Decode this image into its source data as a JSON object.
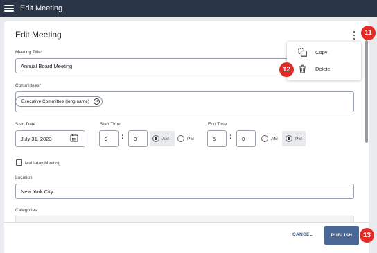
{
  "topbar": {
    "title": "Edit Meeting"
  },
  "card": {
    "title": "Edit Meeting"
  },
  "form": {
    "meeting_title_label": "Meeting Title*",
    "meeting_title_value": "Annual Board Meeting",
    "committees_label": "Committees*",
    "committee_chip": "Executive Committee (long name)",
    "start_date_label": "Start Date",
    "start_date_value": "July 31, 2023",
    "start_time_label": "Start Time",
    "start_hour": "9",
    "start_minute": "0",
    "end_time_label": "End Time",
    "end_hour": "5",
    "end_minute": "0",
    "am": "AM",
    "pm": "PM",
    "start_period": "AM",
    "end_period": "PM",
    "multi_day_label": "Multi-day Meeting",
    "multi_day_checked": false,
    "location_label": "Location",
    "location_value": "New York City",
    "categories_label": "Categories"
  },
  "menu": {
    "items": [
      {
        "label": "Copy",
        "icon": "copy-icon"
      },
      {
        "label": "Delete",
        "icon": "trash-icon"
      }
    ]
  },
  "footer": {
    "cancel_label": "CANCEL",
    "publish_label": "PUBLISH"
  },
  "badges": [
    "11",
    "12",
    "13"
  ],
  "colors": {
    "topbar": "#2b3548",
    "primary_button": "#4b6796",
    "badge": "#e02b27"
  }
}
